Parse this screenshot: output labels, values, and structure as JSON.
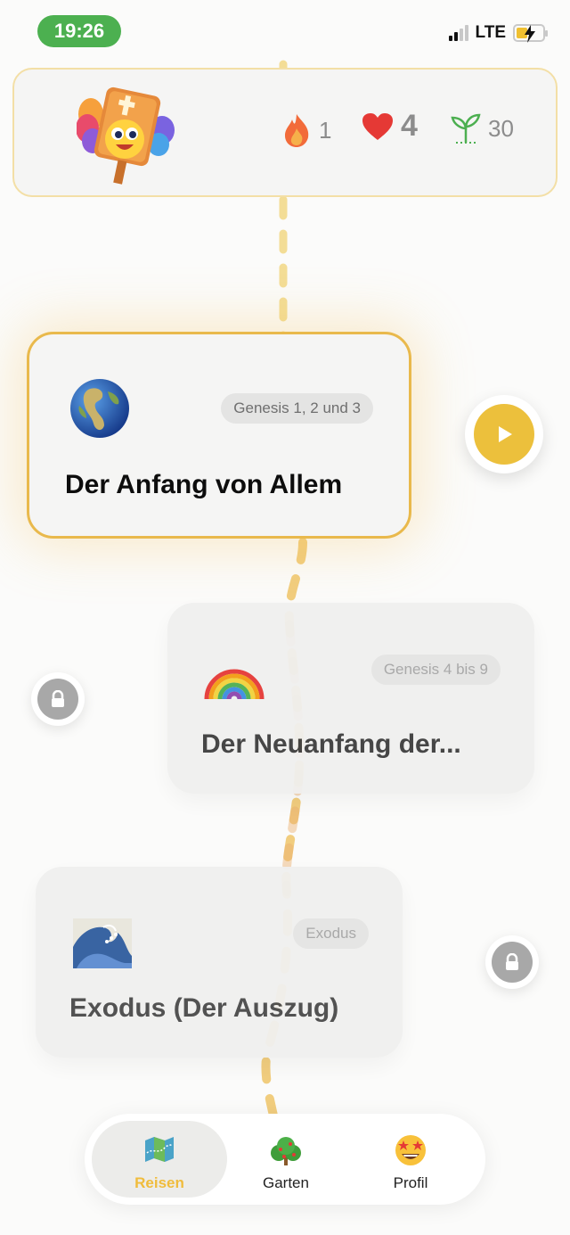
{
  "status_bar": {
    "time": "19:26",
    "network": "LTE",
    "battery_icon": "battery-charging-icon",
    "signal_icon": "signal-bars-icon"
  },
  "header": {
    "mascot_icon": "bible-mascot-icon",
    "streak": {
      "icon": "flame-icon",
      "value": "1"
    },
    "hearts": {
      "icon": "heart-icon",
      "value": "4"
    },
    "seeds": {
      "icon": "sprout-icon",
      "value": "30"
    }
  },
  "lessons": [
    {
      "emoji_icon": "globe-icon",
      "tag": "Genesis 1, 2 und 3",
      "title": "Der Anfang von Allem",
      "state": "active"
    },
    {
      "emoji_icon": "rainbow-icon",
      "tag": "Genesis 4 bis 9",
      "title": "Der Neuanfang der...",
      "state": "locked"
    },
    {
      "emoji_icon": "wave-icon",
      "tag": "Exodus",
      "title": "Exodus (Der Auszug)",
      "state": "locked"
    }
  ],
  "nav": {
    "items": [
      {
        "label": "Reisen",
        "icon": "map-icon",
        "active": true
      },
      {
        "label": "Garten",
        "icon": "bush-icon",
        "active": false
      },
      {
        "label": "Profil",
        "icon": "star-struck-face-icon",
        "active": false
      }
    ]
  },
  "colors": {
    "accent": "#ECC03C",
    "status_green": "#4CB050",
    "active_border": "#E9B94C",
    "heart": "#E53935",
    "flame": "#F26B3A",
    "sprout": "#4CAF50"
  }
}
